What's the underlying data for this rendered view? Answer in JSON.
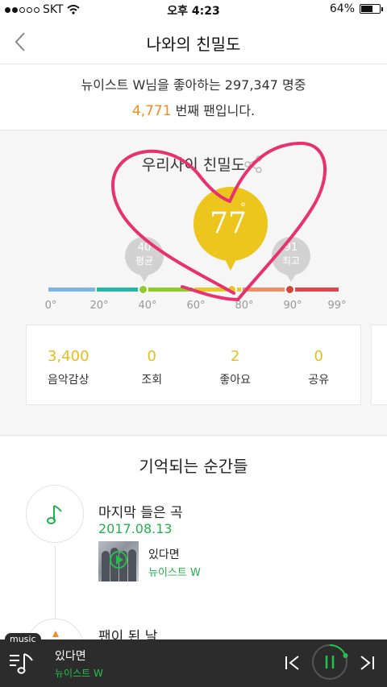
{
  "status_bar": {
    "carrier": "SKT",
    "time": "오후 4:23",
    "battery": "64%",
    "battery_level": 0.64
  },
  "header": {
    "title": "나와의 친밀도"
  },
  "fan_info": {
    "line1": "뉴이스트 W님을 좋아하는 297,347 명중",
    "rank": "4,771",
    "rank_suffix": " 번째 팬입니다."
  },
  "intimacy": {
    "title": "우리사이 친밀도",
    "value": "77",
    "degree": "°",
    "avg_value": "40",
    "avg_label": "평균",
    "max_value": "91",
    "max_label": "최고",
    "scale_ticks": [
      "0°",
      "20°",
      "40°",
      "60°",
      "80°",
      "90°",
      "99°"
    ],
    "scale_colors": [
      "#7fb5e6",
      "#25b7a4",
      "#8dcc2b",
      "#e9c92a",
      "#ef8f68",
      "#e0474c"
    ],
    "colors": {
      "current": "#ecc51d",
      "average": "#8dcc2b",
      "max": "#d6453b"
    }
  },
  "stats": [
    {
      "value": "3,400",
      "label": "음악감상"
    },
    {
      "value": "0",
      "label": "조회"
    },
    {
      "value": "2",
      "label": "좋아요"
    },
    {
      "value": "0",
      "label": "공유"
    }
  ],
  "moments": {
    "title": "기억되는 순간들",
    "items": [
      {
        "label": "마지막 들은 곡",
        "date": "2017.08.13",
        "song": "있다면",
        "artist": "뉴이스트 W",
        "icon": "music-note-icon"
      },
      {
        "label": "팬이 된 날",
        "icon": "calendar-icon"
      }
    ]
  },
  "player": {
    "tag": "music",
    "title": "있다면",
    "artist": "뉴이스트 W",
    "accent": "#24c14e"
  }
}
